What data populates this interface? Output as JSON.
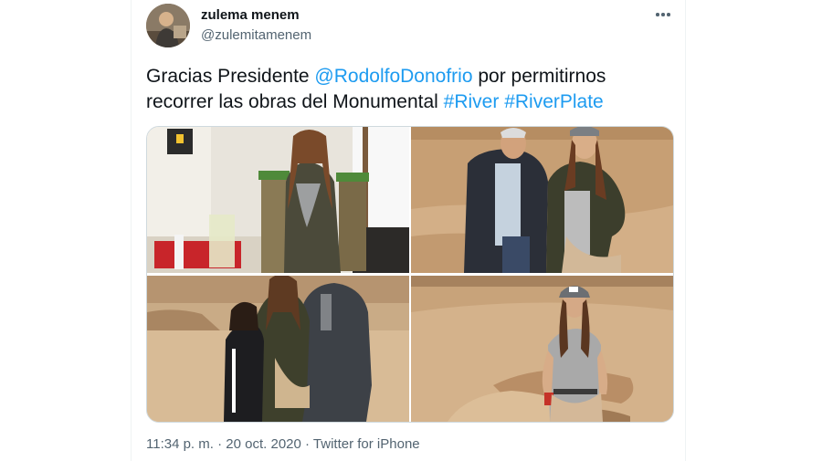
{
  "author": {
    "display_name": "zulema menem",
    "handle": "@zulemitamenem"
  },
  "tweet": {
    "text_prefix": "Gracias Presidente ",
    "mention": "@RodolfoDonofrio",
    "text_middle": " por permitirnos recorrer las obras del Monumental ",
    "hashtag_1": "#River",
    "hashtag_2": "#RiverPlate"
  },
  "media": {
    "photos": [
      {
        "description_icon": "photo-woman-by-window-icon"
      },
      {
        "description_icon": "photo-man-and-woman-icon"
      },
      {
        "description_icon": "photo-woman-child-man-icon"
      },
      {
        "description_icon": "photo-woman-field-icon"
      }
    ]
  },
  "meta": {
    "time": "11:34 p. m.",
    "separator": " · ",
    "date": "20 oct. 2020",
    "source": "Twitter for iPhone"
  },
  "colors": {
    "link": "#1d9bf0",
    "secondary_text": "#536471",
    "primary_text": "#0f1419"
  },
  "icons": {
    "more": "more-dots-icon"
  }
}
